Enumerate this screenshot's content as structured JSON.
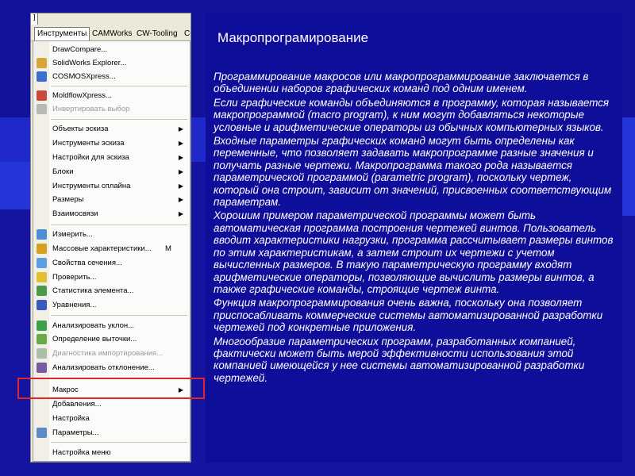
{
  "menu_bar": {
    "title_chip": "]",
    "items": [
      "Инструменты",
      "CAMWorks",
      "CW-Tooling",
      "CO"
    ]
  },
  "menu": {
    "items": [
      {
        "label": "DrawCompare...",
        "icon": "none"
      },
      {
        "label": "SolidWorks Explorer...",
        "icon": "explorer-icon"
      },
      {
        "label": "COSMOSXpress...",
        "icon": "cosmos-icon"
      },
      {
        "label": "MoldflowXpress...",
        "icon": "moldflow-icon"
      },
      {
        "label": "Инвертировать выбор",
        "icon": "invert-selection-icon",
        "disabled": true
      },
      {
        "label": "Объекты эскиза",
        "submenu": true
      },
      {
        "label": "Инструменты эскиза",
        "submenu": true
      },
      {
        "label": "Настройки для эскиза",
        "submenu": true
      },
      {
        "label": "Блоки",
        "submenu": true
      },
      {
        "label": "Инструменты сплайна",
        "submenu": true
      },
      {
        "label": "Размеры",
        "submenu": true
      },
      {
        "label": "Взаимосвязи",
        "submenu": true
      },
      {
        "label": "Измерить...",
        "icon": "measure-icon"
      },
      {
        "label": "Массовые характеристики...",
        "icon": "mass-properties-icon",
        "shortcut": "M"
      },
      {
        "label": "Свойства сечения...",
        "icon": "section-properties-icon"
      },
      {
        "label": "Проверить...",
        "icon": "check-icon"
      },
      {
        "label": "Статистика элемента...",
        "icon": "feature-statistics-icon"
      },
      {
        "label": "Уравнения...",
        "icon": "equations-icon"
      },
      {
        "label": "Анализировать уклон...",
        "icon": "draft-analysis-icon"
      },
      {
        "label": "Определение выточки...",
        "icon": "undercut-detection-icon"
      },
      {
        "label": "Диагностика импортирования...",
        "icon": "import-diagnostics-icon",
        "disabled": true
      },
      {
        "label": "Анализировать отклонение...",
        "icon": "deviation-analysis-icon"
      },
      {
        "label": "Макрос",
        "submenu": true
      },
      {
        "label": "Добавления...",
        "icon": "none"
      },
      {
        "label": "Настройка",
        "icon": "none"
      },
      {
        "label": "Параметры...",
        "icon": "options-icon"
      },
      {
        "label": "Настройка меню",
        "icon": "none"
      }
    ]
  },
  "slide": {
    "title": "Макропрограмирование",
    "paragraphs": [
      "Программирование макросов или макропрограммирование заключается в объединении наборов графических команд под одним именем.",
      "Если графические команды объединяются в программу, которая называется макропрограммой (macro program), к ним могут добавляться некоторые условные и арифметические операторы из обычных компьютерных языков.",
      "Входные параметры графических команд могут быть определены как переменные, что позволяет задавать макропрограмме разные значения и получать разные чертежи. Макропрограмма такого рода называется параметрической программой (parametric program), поскольку чертеж, который она строит, зависит от значений, присвоенных соответствующим параметрам.",
      "Хорошим примером параметрической программы может быть автоматическая программа построения чертежей винтов. Пользователь вводит характеристики нагрузки, программа рассчитывает размеры винтов по этим характеристикам, а затем строит их чертежи с учетом вычисленных размеров. В такую параметрическую программу входят арифметические операторы, позволяющие вычислить размеры винтов, а также графические команды, строящие чертеж винта.",
      "Функция макропрограммирования очень важна, поскольку она позволяет приспосабливать коммерческие системы автоматизированной разработки чертежей под конкретные приложения.",
      "Многообразие параметрических программ, разработанных компанией, фактически может быть мерой эффективности использования этой компанией имеющейся у нее системы автоматизированной разработки чертежей."
    ]
  },
  "colors": {
    "background": "#1a1aa8",
    "slide_panel": "#0e0e9a",
    "highlight_border": "#e0262a"
  }
}
